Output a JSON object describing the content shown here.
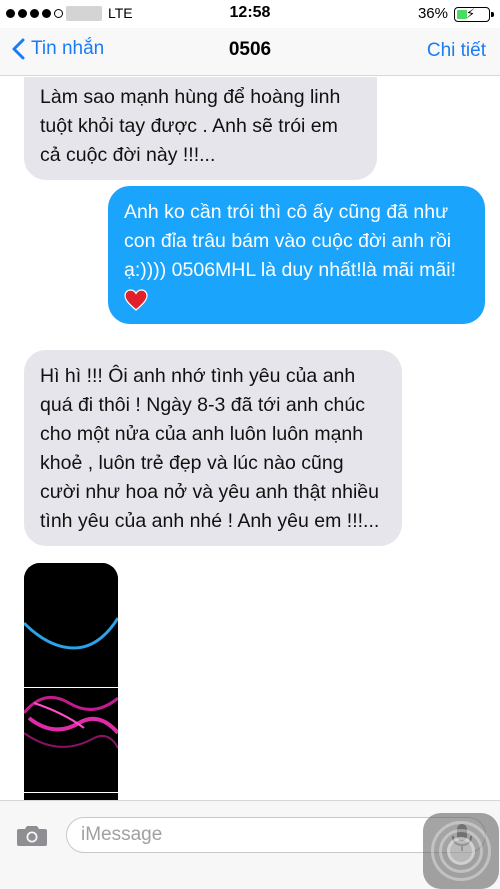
{
  "status_bar": {
    "network": "LTE",
    "time": "12:58",
    "battery_percent": "36%",
    "battery_level": 0.36,
    "signal_bars_filled": 4
  },
  "nav": {
    "back_label": "Tin nhắn",
    "title": "0506",
    "details_label": "Chi tiết"
  },
  "messages": [
    {
      "direction": "incoming",
      "text": "Làm sao mạnh hùng để hoàng linh tuột khỏi tay được . Anh sẽ trói em cả cuộc đời này !!!..."
    },
    {
      "direction": "outgoing",
      "text": "Anh ko cần trói thì cô ấy cũng đã như con đỉa trâu bám vào cuộc đời anh rồi ạ:)))) 0506MHL là duy nhất!là mãi mãi!",
      "emoji": "red-heart"
    },
    {
      "direction": "incoming",
      "text": "Hì hì !!! Ôi anh nhớ tình yêu của anh quá đi thôi ! Ngày 8-3 đã tới anh chúc cho một nửa của anh luôn luôn mạnh khoẻ , luôn trẻ đẹp và lúc nào cũng cười như hoa nở và yêu anh thật nhiều tình yêu của anh nhé ! Anh yêu em !!!..."
    },
    {
      "direction": "incoming",
      "type": "image",
      "icon": "image-attachment"
    }
  ],
  "input": {
    "placeholder": "iMessage"
  },
  "colors": {
    "accent": "#1a7cf5",
    "outgoing_bubble": "#1aa4fc",
    "incoming_bubble": "#e6e5eb"
  }
}
